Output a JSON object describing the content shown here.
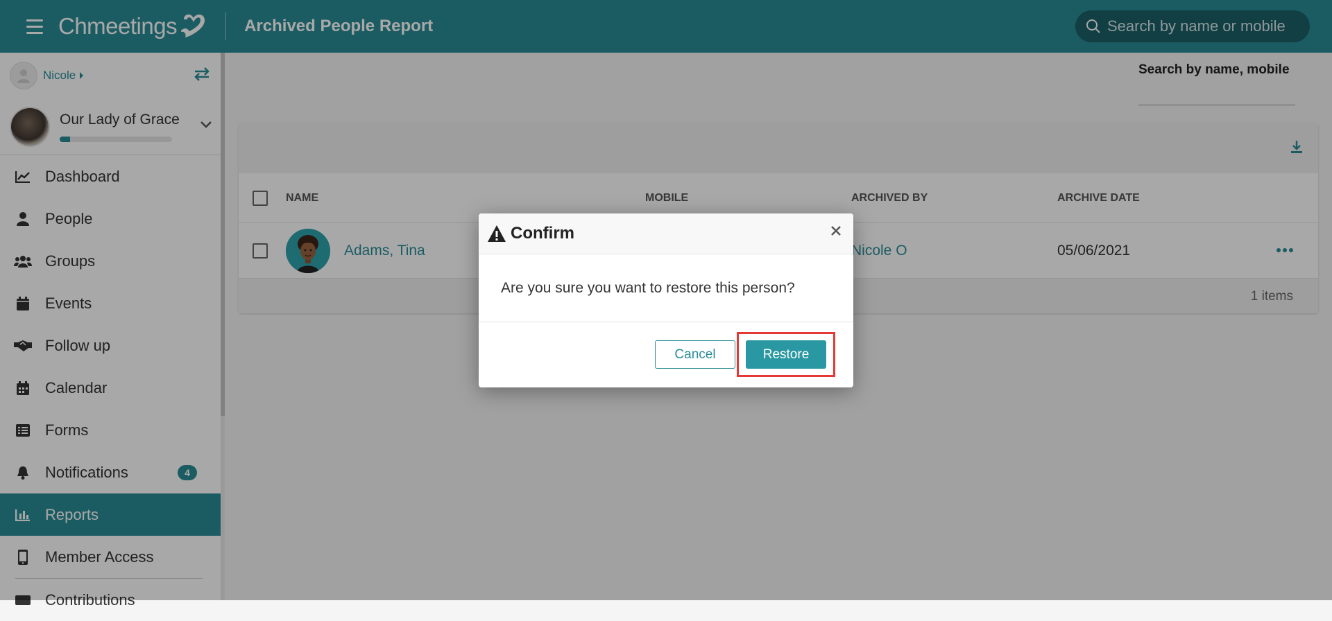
{
  "header": {
    "logo_text": "Chmeetings",
    "title": "Archived People Report",
    "search_placeholder": "Search by name or mobile"
  },
  "sidebar": {
    "user_name": "Nicole",
    "org_name": "Our Lady of Grace",
    "org_progress": 0.09,
    "items": [
      {
        "label": "Dashboard",
        "icon": "chart-line-icon"
      },
      {
        "label": "People",
        "icon": "person-icon"
      },
      {
        "label": "Groups",
        "icon": "groups-icon"
      },
      {
        "label": "Events",
        "icon": "calendar-icon"
      },
      {
        "label": "Follow up",
        "icon": "handshake-icon"
      },
      {
        "label": "Calendar",
        "icon": "calendar-grid-icon"
      },
      {
        "label": "Forms",
        "icon": "list-icon"
      },
      {
        "label": "Notifications",
        "icon": "bell-icon",
        "badge": "4"
      },
      {
        "label": "Reports",
        "icon": "bar-chart-icon",
        "active": true
      },
      {
        "label": "Member Access",
        "icon": "mobile-icon"
      },
      {
        "label": "Contributions",
        "icon": "contributions-icon"
      }
    ]
  },
  "filter": {
    "label": "Search by name, mobile",
    "value": ""
  },
  "table": {
    "columns": [
      "NAME",
      "MOBILE",
      "ARCHIVED BY",
      "ARCHIVE DATE"
    ],
    "rows": [
      {
        "name": "Adams, Tina",
        "mobile": "",
        "archived_by": "Nicole O",
        "archive_date": "05/06/2021"
      }
    ],
    "footer": "1 items"
  },
  "modal": {
    "title": "Confirm",
    "message": "Are you sure you want to restore this person?",
    "cancel_label": "Cancel",
    "restore_label": "Restore"
  },
  "colors": {
    "brand": "#2a8c96",
    "highlight": "#e53935"
  }
}
